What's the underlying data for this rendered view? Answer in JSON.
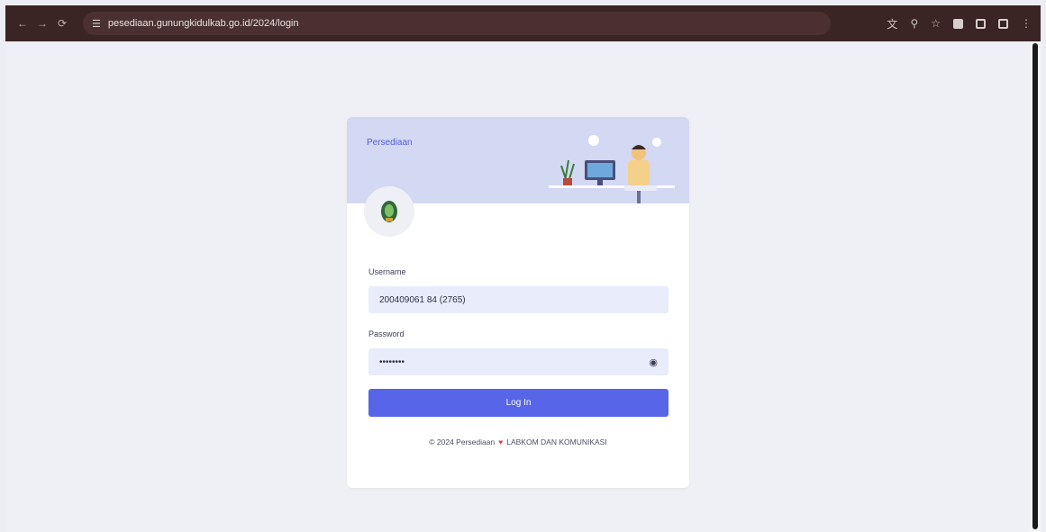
{
  "browser": {
    "url": "pesediaan.gunungkidulkab.go.id/2024/login",
    "nav": [
      "←",
      "→",
      "⟳"
    ]
  },
  "login": {
    "brand": "Persediaan",
    "username_label": "Username",
    "username_value": "200409061 84 (2765)",
    "password_label": "Password",
    "password_value": "••••••••",
    "login_button": "Log In",
    "footer_text": "© 2024 Persediaan",
    "footer_credit": "LABKOM DAN KOMUNIKASI"
  },
  "colors": {
    "accent": "#5765e8",
    "banner": "#d3d8f3",
    "field_bg": "#e8ecfb",
    "chrome": "#3b2424",
    "heart": "#ef3b58"
  }
}
